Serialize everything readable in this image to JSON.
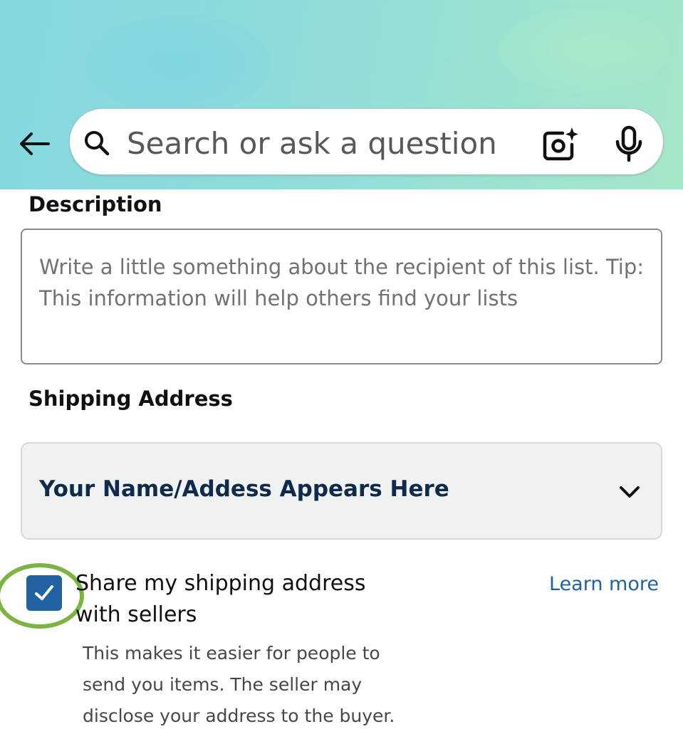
{
  "header": {
    "back_icon": "back-arrow-icon",
    "search": {
      "placeholder": "Search or ask a question",
      "search_icon": "search-icon",
      "camera_icon": "camera-sparkle-icon",
      "mic_icon": "microphone-icon"
    }
  },
  "form": {
    "description": {
      "label": "Description",
      "placeholder": "Write a little something about the recipient of this list. Tip: This information will help others find your lists"
    },
    "shipping": {
      "label": "Shipping Address",
      "selected_address": "Your Name/Addess Appears Here",
      "chevron_icon": "chevron-down-icon"
    },
    "share": {
      "checked": true,
      "label": "Share my shipping address with sellers",
      "learn_more": "Learn more",
      "helper": "This makes it easier for people to send you items. The seller may disclose your address to the buyer."
    }
  },
  "colors": {
    "checkbox": "#2162a1",
    "link": "#2162a1",
    "highlight_ring": "#7cb342",
    "address_text": "#0f2a4a"
  }
}
